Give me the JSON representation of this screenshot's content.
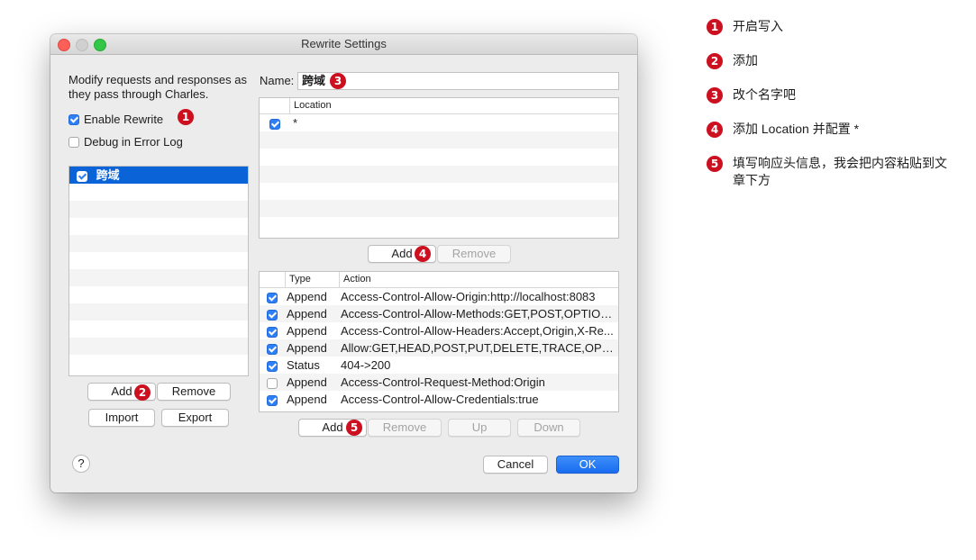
{
  "window": {
    "title": "Rewrite Settings"
  },
  "left": {
    "description": "Modify requests and responses as they pass through Charles.",
    "enable_rewrite": {
      "label": "Enable Rewrite",
      "checked": true
    },
    "debug_log": {
      "label": "Debug in Error Log",
      "checked": false
    },
    "rules": [
      {
        "name": "跨域",
        "checked": true,
        "selected": true
      }
    ],
    "buttons": {
      "add": "Add",
      "remove": "Remove",
      "import": "Import",
      "export": "Export"
    }
  },
  "right": {
    "name_label": "Name:",
    "name_value": "跨域",
    "locations": {
      "header": "Location",
      "rows": [
        {
          "checked": true,
          "location": "*"
        }
      ],
      "add": "Add",
      "remove": "Remove"
    },
    "actions": {
      "headers": {
        "type": "Type",
        "action": "Action"
      },
      "rows": [
        {
          "checked": true,
          "type": "Append",
          "action": "Access-Control-Allow-Origin:http://localhost:8083"
        },
        {
          "checked": true,
          "type": "Append",
          "action": "Access-Control-Allow-Methods:GET,POST,OPTIONS"
        },
        {
          "checked": true,
          "type": "Append",
          "action": "Access-Control-Allow-Headers:Accept,Origin,X-Re..."
        },
        {
          "checked": true,
          "type": "Append",
          "action": "Allow:GET,HEAD,POST,PUT,DELETE,TRACE,OPTIO..."
        },
        {
          "checked": true,
          "type": "Status",
          "action": "404->200"
        },
        {
          "checked": false,
          "type": "Append",
          "action": "Access-Control-Request-Method:Origin"
        },
        {
          "checked": true,
          "type": "Append",
          "action": "Access-Control-Allow-Credentials:true"
        }
      ],
      "add": "Add",
      "remove": "Remove",
      "up": "Up",
      "down": "Down"
    }
  },
  "footer": {
    "help": "?",
    "cancel": "Cancel",
    "ok": "OK"
  },
  "badges": [
    "1",
    "2",
    "3",
    "4",
    "5"
  ],
  "notes": [
    {
      "num": "1",
      "text": "开启写入"
    },
    {
      "num": "2",
      "text": "添加"
    },
    {
      "num": "3",
      "text": "改个名字吧"
    },
    {
      "num": "4",
      "text": "添加 Location 并配置 *"
    },
    {
      "num": "5",
      "text": "填写响应头信息，我会把内容粘贴到文章下方"
    }
  ],
  "colors": {
    "accent": "#2e7ef6",
    "selection": "#0a63d7",
    "badge": "#cc1020"
  }
}
